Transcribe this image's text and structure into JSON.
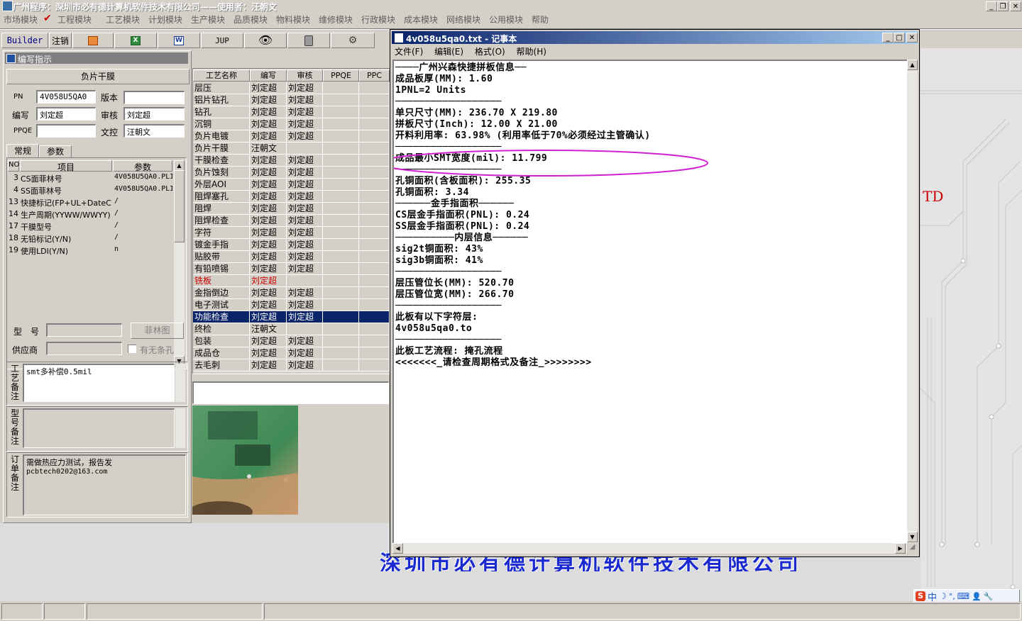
{
  "window": {
    "title": "广州程序：深圳市必有德计算机软件技术有限公司——使用者：汪朝文",
    "controls": [
      "_",
      "❐",
      "✕"
    ]
  },
  "menu": [
    "市场模块",
    "工程模块",
    "工艺模块",
    "计划模块",
    "生产模块",
    "品质模块",
    "物料模块",
    "维修模块",
    "行政模块",
    "成本模块",
    "网络模块",
    "公用模块",
    "帮助"
  ],
  "toolbar": {
    "builder": "Builder",
    "logout": "注销",
    "jup": "JUP"
  },
  "panel": {
    "title": "编写指示",
    "film_header": "负片干膜",
    "pn_label": "PN",
    "pn_value": "4V058U5QA0",
    "version_label": "版本",
    "version_value": "",
    "writer_label": "编写",
    "writer_value": "刘定超",
    "review_label": "审核",
    "review_value": "刘定超",
    "ppqe_label": "PPQE",
    "ppqe_value": "",
    "doc_label": "文控",
    "doc_value": "汪朝文",
    "tabs": [
      "常规",
      "参数"
    ],
    "grid_headers": [
      "NO",
      "项目",
      "参数"
    ],
    "grid_rows": [
      {
        "no": "3",
        "item": "CS面菲林号",
        "param": "4V058U5QA0.PLI"
      },
      {
        "no": "4",
        "item": "SS面菲林号",
        "param": "4V058U5QA0.PLI"
      },
      {
        "no": "13",
        "item": "快捷标记(FP+UL+DateC",
        "param": "/"
      },
      {
        "no": "14",
        "item": "生产周期(YYWW/WWYY)",
        "param": "/"
      },
      {
        "no": "17",
        "item": "干膜型号",
        "param": "/"
      },
      {
        "no": "18",
        "item": "无铅标记(Y/N)",
        "param": "/"
      },
      {
        "no": "19",
        "item": "使用LDI(Y/N)",
        "param": "n"
      }
    ],
    "model_label": "型　号",
    "film_button": "菲林图",
    "supplier_label": "供应商",
    "has_no_hole": "有无条孔",
    "process_note_label": "工艺备注",
    "process_note": "smt多补偿0.5mil",
    "model_note_label": "型号备注",
    "model_note": "",
    "order_note_label": "订单备注",
    "order_note_1": "需做热应力测试，报告发",
    "order_note_2": "pcbtech0202@163.com"
  },
  "process_table": {
    "headers": [
      "工艺名称",
      "编写",
      "审核",
      "PPQE",
      "PPC"
    ],
    "rows": [
      {
        "name": "层压",
        "writer": "刘定超",
        "reviewer": "刘定超"
      },
      {
        "name": "铝片钻孔",
        "writer": "刘定超",
        "reviewer": "刘定超"
      },
      {
        "name": "钻孔",
        "writer": "刘定超",
        "reviewer": "刘定超"
      },
      {
        "name": "沉铜",
        "writer": "刘定超",
        "reviewer": "刘定超"
      },
      {
        "name": "负片电镀",
        "writer": "刘定超",
        "reviewer": "刘定超"
      },
      {
        "name": "负片干膜",
        "writer": "汪朝文",
        "reviewer": ""
      },
      {
        "name": "干膜检查",
        "writer": "刘定超",
        "reviewer": "刘定超"
      },
      {
        "name": "负片蚀刻",
        "writer": "刘定超",
        "reviewer": "刘定超"
      },
      {
        "name": "外层AOI",
        "writer": "刘定超",
        "reviewer": "刘定超"
      },
      {
        "name": "阻焊塞孔",
        "writer": "刘定超",
        "reviewer": "刘定超"
      },
      {
        "name": "阻焊",
        "writer": "刘定超",
        "reviewer": "刘定超"
      },
      {
        "name": "阻焊检查",
        "writer": "刘定超",
        "reviewer": "刘定超"
      },
      {
        "name": "字符",
        "writer": "刘定超",
        "reviewer": "刘定超"
      },
      {
        "name": "镀金手指",
        "writer": "刘定超",
        "reviewer": "刘定超"
      },
      {
        "name": "贴胶带",
        "writer": "刘定超",
        "reviewer": "刘定超"
      },
      {
        "name": "有铅喷锡",
        "writer": "刘定超",
        "reviewer": "刘定超"
      },
      {
        "name": "铣板",
        "writer": "刘定超",
        "reviewer": "",
        "highlight": "red"
      },
      {
        "name": "金指倒边",
        "writer": "刘定超",
        "reviewer": "刘定超"
      },
      {
        "name": "电子测试",
        "writer": "刘定超",
        "reviewer": "刘定超"
      },
      {
        "name": "功能检查",
        "writer": "刘定超",
        "reviewer": "刘定超",
        "selected": true
      },
      {
        "name": "终检",
        "writer": "汪朝文",
        "reviewer": ""
      },
      {
        "name": "包装",
        "writer": "刘定超",
        "reviewer": "刘定超"
      },
      {
        "name": "成品仓",
        "writer": "刘定超",
        "reviewer": "刘定超"
      },
      {
        "name": "去毛刺",
        "writer": "刘定超",
        "reviewer": "刘定超"
      }
    ]
  },
  "notepad": {
    "title": "4v058u5qa0.txt - 记事本",
    "menu": [
      "文件(F)",
      "编辑(E)",
      "格式(O)",
      "帮助(H)"
    ],
    "lines": [
      "────广州兴森快捷拼板信息──",
      "成品板厚(MM): 1.60",
      "1PNL=2 Units",
      "──────────────────",
      "单只尺寸(MM): 236.70 X 219.80",
      "拼板尺寸(Inch): 12.00 X 21.00",
      "开料利用率: 63.98% (利用率低于70%必须经过主管确认)",
      "──────────────────",
      "成品最小SMT宽度(mil): 11.799",
      "──────────────────",
      "孔铜面积(含板面积): 255.35",
      "孔铜面积: 3.34",
      "──────金手指面积──────",
      "CS层金手指面积(PNL): 0.24",
      "SS层金手指面积(PNL): 0.24",
      "──────────内层信息──────",
      "sig2t铜面积: 43%",
      "sig3b铜面积: 41%",
      "──────────────────",
      "层压管位长(MM): 520.70",
      "层压管位宽(MM): 266.70",
      "──────────────────",
      "此板有以下字符层:",
      "4v058u5qa0.to",
      "──────────────────",
      "此板工艺流程: 掩孔流程",
      "<<<<<<<_请检查周期格式及备注_>>>>>>>>"
    ]
  },
  "desktop": {
    "td_label": "TD",
    "watermark": "深圳市必有德计算机软件技术有限公司",
    "ime": [
      "S",
      "中",
      "☽",
      "°,",
      "⌨",
      "👤",
      "🔧"
    ]
  },
  "colors": {
    "red_text": "#cc0000",
    "selection": "#0a246a",
    "highlight_ellipse": "#d020d0",
    "watermark": "#1a2ad0"
  }
}
